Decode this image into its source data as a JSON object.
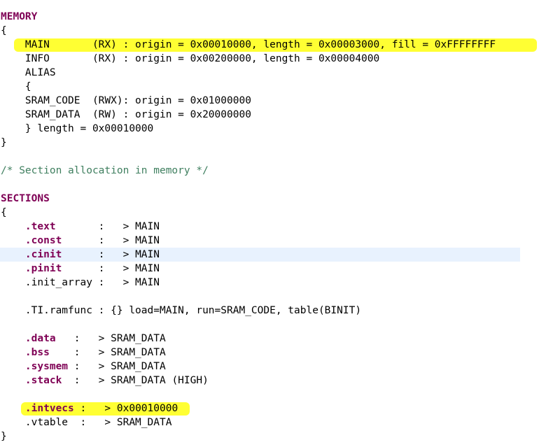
{
  "memory": {
    "keyword": "MEMORY",
    "open": "{",
    "main_line": "    MAIN       (RX) : origin = 0x00010000, length = 0x00003000, fill = 0xFFFFFFFF",
    "info_line": "    INFO       (RX) : origin = 0x00200000, length = 0x00004000",
    "alias_line": "    ALIAS",
    "alias_open": "    {",
    "sram_code_line": "    SRAM_CODE  (RWX): origin = 0x01000000",
    "sram_data_line": "    SRAM_DATA  (RW) : origin = 0x20000000",
    "alias_close": "    } length = 0x00010000",
    "close": "}"
  },
  "comment": "/* Section allocation in memory */",
  "sections": {
    "keyword": "SECTIONS",
    "open": "{",
    "text_name": ".text",
    "text_rest": "       :   > MAIN",
    "const_name": ".const",
    "const_rest": "      :   > MAIN",
    "cinit_name": ".cinit",
    "cinit_rest": "      :   > MAIN",
    "pinit_name": ".pinit",
    "pinit_rest": "      :   > MAIN",
    "init_array_line": "    .init_array :   > MAIN",
    "ramfunc_line": "    .TI.ramfunc : {} load=MAIN, run=SRAM_CODE, table(BINIT)",
    "data_name": ".data",
    "data_rest": "   :   > SRAM_DATA",
    "bss_name": ".bss",
    "bss_rest": "    :   > SRAM_DATA",
    "sysmem_name": ".sysmem",
    "sysmem_rest": " :   > SRAM_DATA",
    "stack_name": ".stack",
    "stack_rest": "  :   > SRAM_DATA (HIGH)",
    "intvecs_name": ".intvecs",
    "intvecs_rest": " :   > 0x00010000",
    "vtable_line": "    .vtable  :   > SRAM_DATA",
    "close": "}"
  },
  "indent": "    ",
  "colors": {
    "keyword": "#7f0055",
    "comment": "#3f7f5f",
    "highlight": "#ffff33",
    "current_line": "#e8f2fe"
  }
}
